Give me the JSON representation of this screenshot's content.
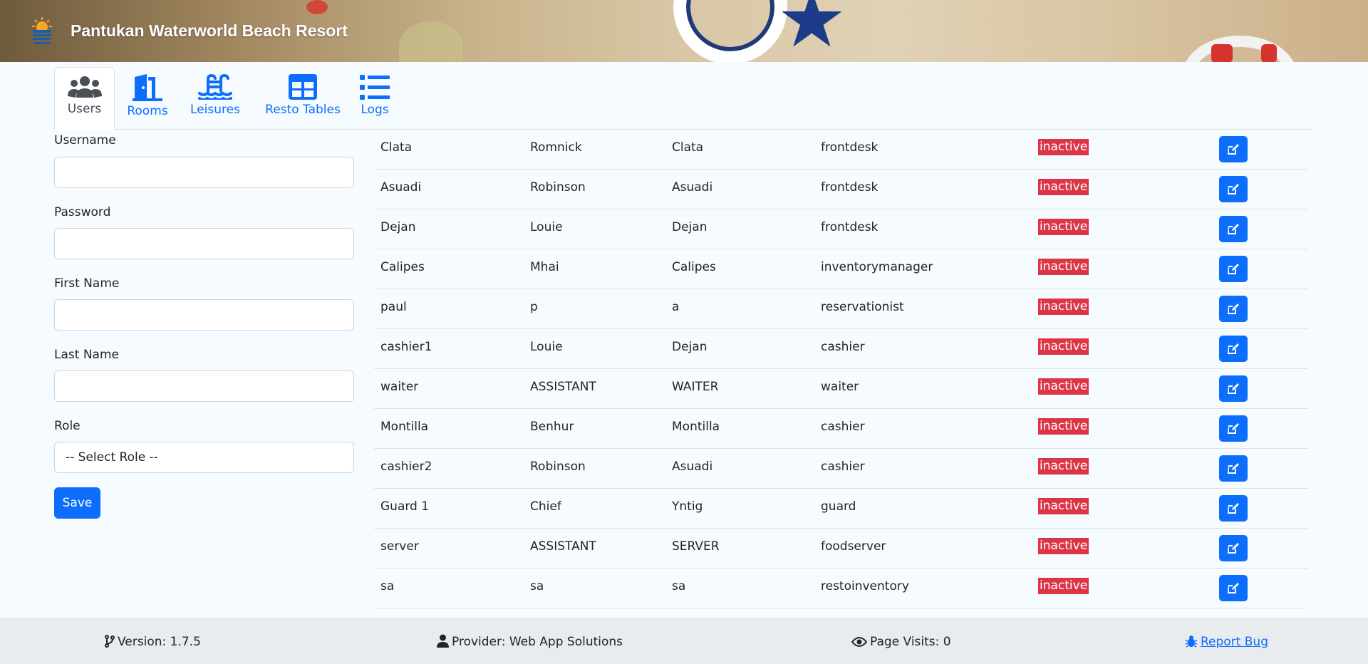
{
  "app": {
    "title": "Pantukan Waterworld Beach Resort"
  },
  "tabs": [
    {
      "label": "Users",
      "icon": "users-icon",
      "active": true
    },
    {
      "label": "Rooms",
      "icon": "door-icon"
    },
    {
      "label": "Leisures",
      "icon": "pool-icon"
    },
    {
      "label": "Resto Tables",
      "icon": "table-icon"
    },
    {
      "label": "Logs",
      "icon": "list-icon"
    }
  ],
  "form": {
    "username_label": "Username",
    "username_value": "",
    "password_label": "Password",
    "password_value": "",
    "firstname_label": "First Name",
    "firstname_value": "",
    "lastname_label": "Last Name",
    "lastname_value": "",
    "role_label": "Role",
    "role_selected": "-- Select Role --",
    "save_label": "Save"
  },
  "users": [
    {
      "username": "Clata",
      "first": "Romnick",
      "last": "Clata",
      "role": "frontdesk",
      "status": "inactive"
    },
    {
      "username": "Asuadi",
      "first": "Robinson",
      "last": "Asuadi",
      "role": "frontdesk",
      "status": "inactive"
    },
    {
      "username": "Dejan",
      "first": "Louie",
      "last": "Dejan",
      "role": "frontdesk",
      "status": "inactive"
    },
    {
      "username": "Calipes",
      "first": "Mhai",
      "last": "Calipes",
      "role": "inventorymanager",
      "status": "inactive"
    },
    {
      "username": "paul",
      "first": "p",
      "last": "a",
      "role": "reservationist",
      "status": "inactive"
    },
    {
      "username": "cashier1",
      "first": "Louie",
      "last": "Dejan",
      "role": "cashier",
      "status": "inactive"
    },
    {
      "username": "waiter",
      "first": "ASSISTANT",
      "last": "WAITER",
      "role": "waiter",
      "status": "inactive"
    },
    {
      "username": "Montilla",
      "first": "Benhur",
      "last": "Montilla",
      "role": "cashier",
      "status": "inactive"
    },
    {
      "username": "cashier2",
      "first": "Robinson",
      "last": "Asuadi",
      "role": "cashier",
      "status": "inactive"
    },
    {
      "username": "Guard 1",
      "first": "Chief",
      "last": "Yntig",
      "role": "guard",
      "status": "inactive"
    },
    {
      "username": "server",
      "first": "ASSISTANT",
      "last": "SERVER",
      "role": "foodserver",
      "status": "inactive"
    },
    {
      "username": "sa",
      "first": "sa",
      "last": "sa",
      "role": "restoinventory",
      "status": "inactive"
    }
  ],
  "footer": {
    "version": "Version: 1.7.5",
    "provider": "Provider: Web App Solutions",
    "visits": "Page Visits: 0",
    "report": "Report Bug"
  },
  "colors": {
    "primary": "#0d6efd",
    "danger": "#dc3545",
    "page_bg": "#f5fbff",
    "footer_bg": "#e9ecef"
  }
}
